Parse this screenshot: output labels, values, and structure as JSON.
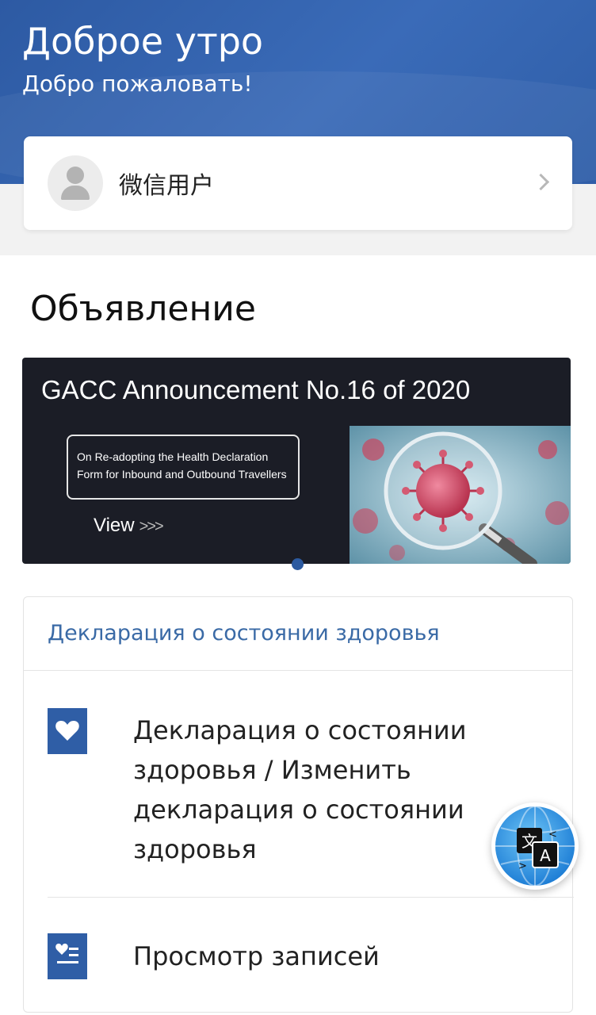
{
  "header": {
    "greeting": "Доброе утро",
    "welcome": "Добро пожаловать!"
  },
  "user": {
    "name": "微信用户"
  },
  "announcement": {
    "section_title": "Объявление",
    "banner_title": "GACC Announcement No.16 of 2020",
    "banner_line1": "On Re-adopting the Health Declaration",
    "banner_line2": "Form for Inbound and Outbound Travellers",
    "banner_view": "View",
    "banner_arrows": ">>>"
  },
  "health_card": {
    "header": "Декларация о состоянии здоровья",
    "items": [
      {
        "label": "Декларация о состоянии здоровья / Изменить декларация о состоянии здоровья",
        "icon": "heart-icon"
      },
      {
        "label": "Просмотр записей",
        "icon": "heart-list-icon"
      }
    ]
  },
  "colors": {
    "header_blue": "#2d5aa3",
    "accent_blue": "#2f5ea6",
    "link_blue": "#3a6aa6"
  }
}
